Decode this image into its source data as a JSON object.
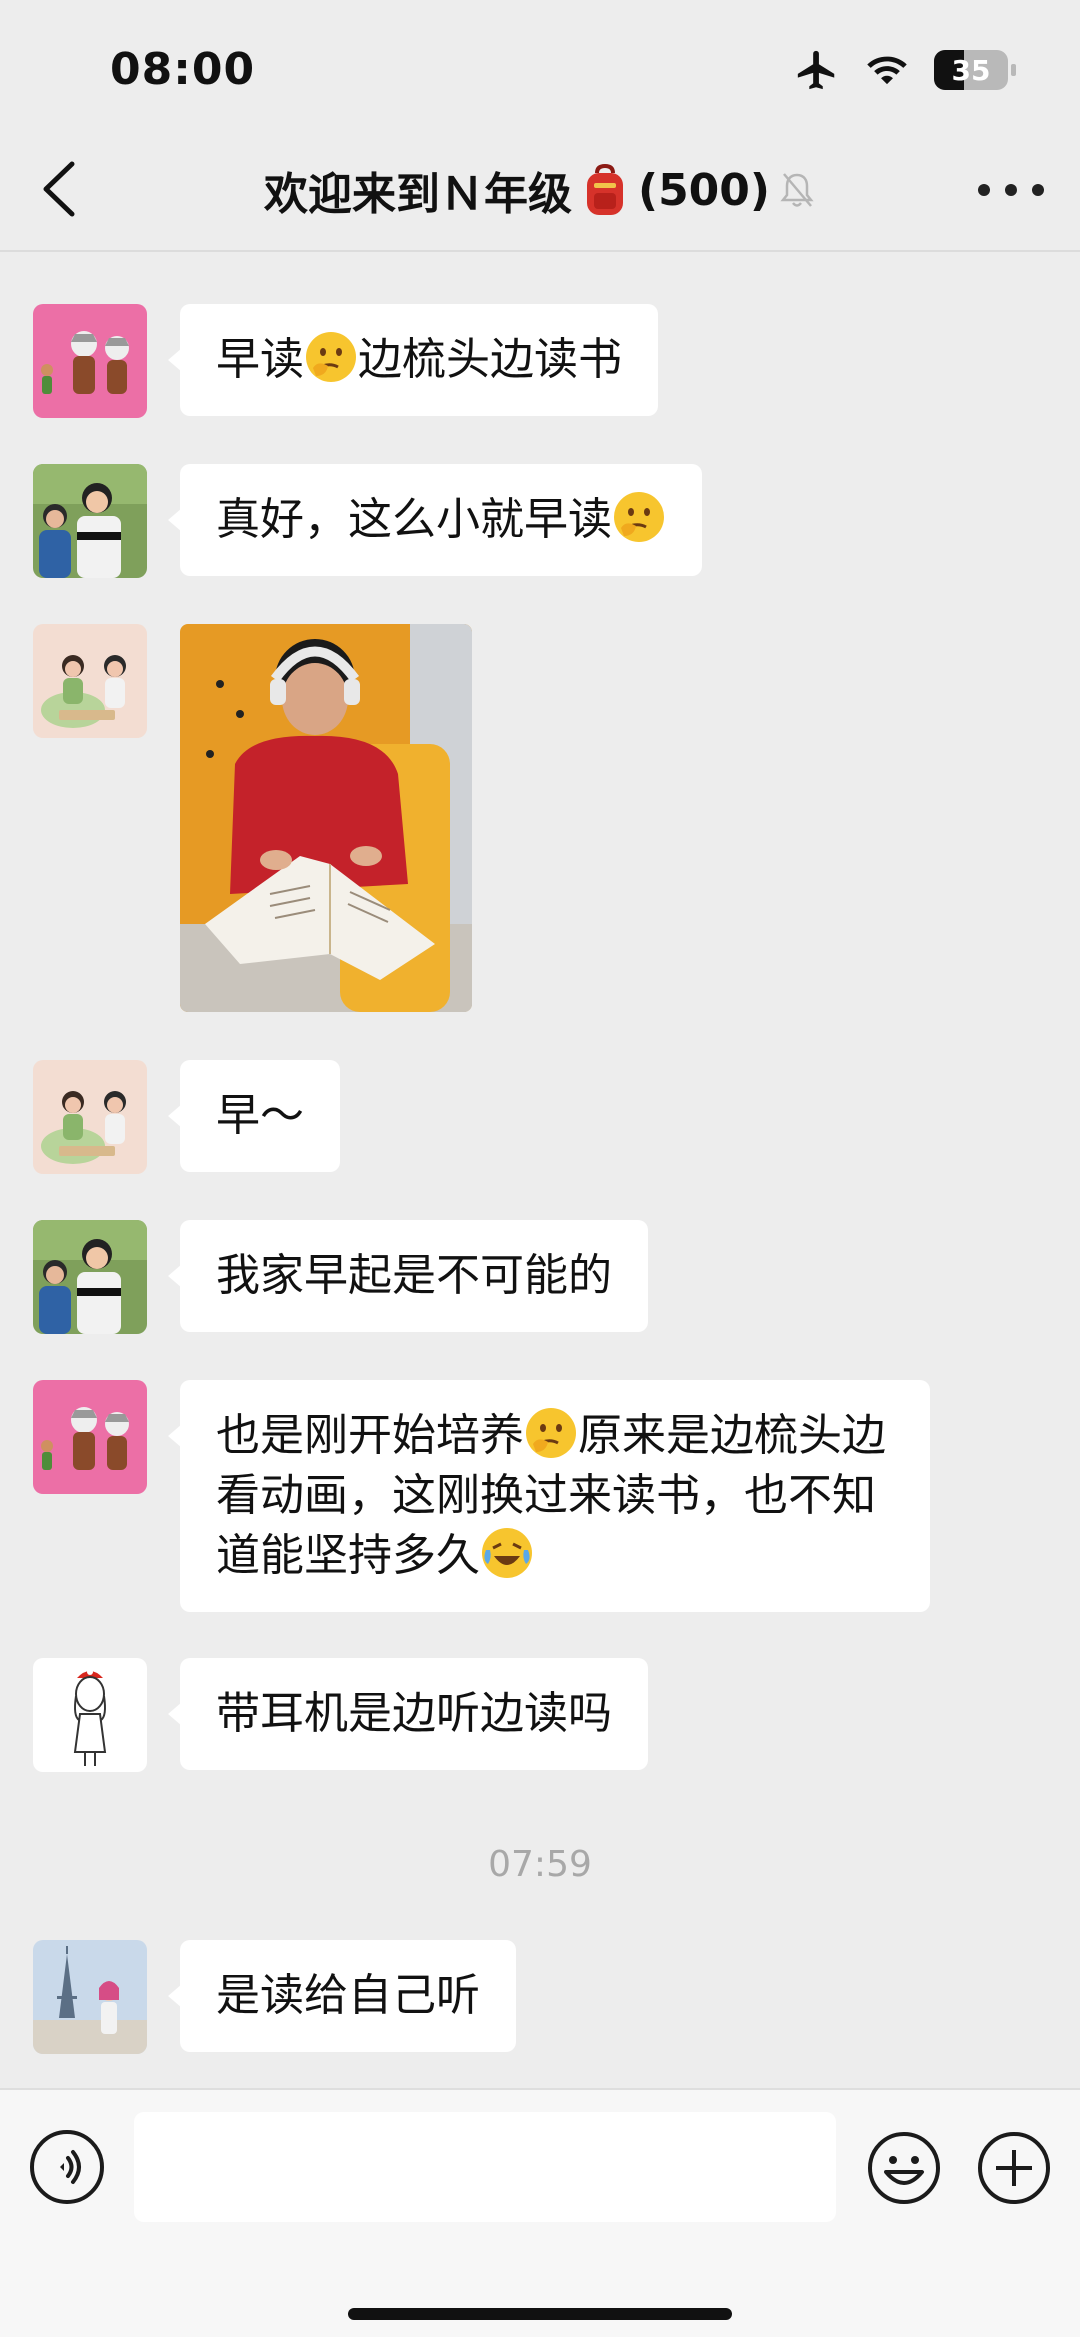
{
  "status_bar": {
    "time": "08:00",
    "battery": "35"
  },
  "header": {
    "title": "欢迎来到Ｎ年级",
    "member_count": "(500)"
  },
  "messages": [
    {
      "type": "text",
      "parts": [
        "早读",
        "边梳头边读书"
      ]
    },
    {
      "type": "text",
      "parts": [
        "真好，这么小就早读",
        ""
      ]
    },
    {
      "type": "image"
    },
    {
      "type": "text",
      "parts": [
        "早～"
      ]
    },
    {
      "type": "text",
      "parts": [
        "我家早起是不可能的"
      ]
    },
    {
      "type": "text",
      "parts": [
        "也是刚开始培养",
        "原来是边梳头边看动画，这刚换过来读书，也不知道能坚持多久"
      ]
    },
    {
      "type": "text",
      "parts": [
        "带耳机是边听边读吗"
      ]
    },
    {
      "type": "timestamp",
      "text": "07:59"
    },
    {
      "type": "text",
      "parts": [
        "是读给自己听"
      ]
    }
  ],
  "colors": {
    "background": "#ededed",
    "bubble": "#ffffff",
    "timestamp": "#a8a8a8",
    "input_bar": "#f7f7f7"
  },
  "icons": [
    "airplane-icon",
    "wifi-icon",
    "battery-icon",
    "back-icon",
    "backpack-emoji",
    "mute-bell-icon",
    "more-icon",
    "thinking-emoji",
    "laughing-tears-emoji",
    "voice-icon",
    "emoji-icon",
    "plus-icon"
  ]
}
